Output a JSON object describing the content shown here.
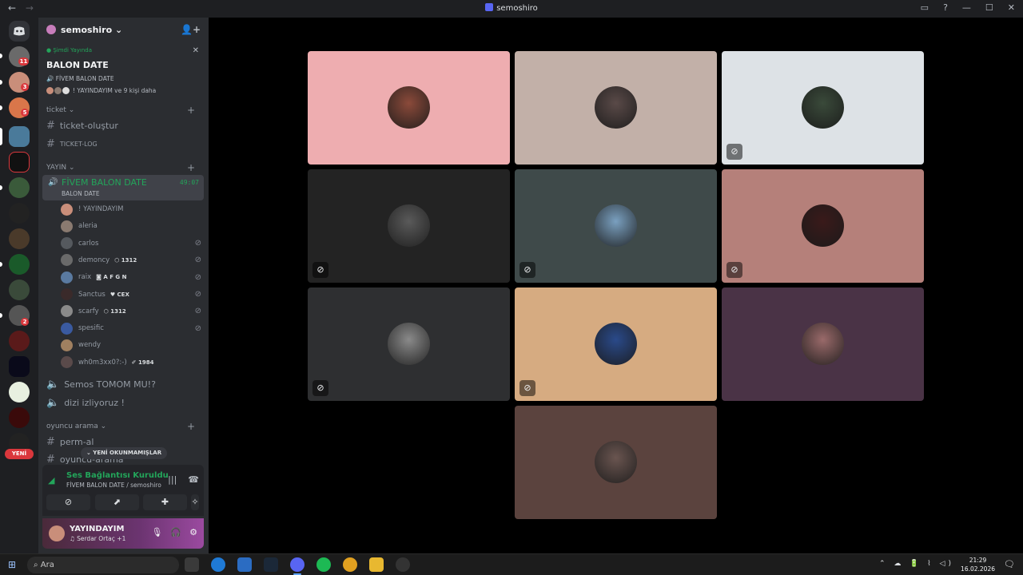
{
  "window": {
    "title": "semoshiro",
    "nav_back": "←",
    "nav_fwd": "→",
    "ctrl_inbox": "▭",
    "ctrl_help": "?",
    "ctrl_min": "—",
    "ctrl_max": "☐",
    "ctrl_close": "✕"
  },
  "server": {
    "name": "semoshiro ⌄",
    "invite_icon": "👤+"
  },
  "event": {
    "live_label": "● Şimdi Yayında",
    "title": "BALON DATE",
    "channel": "🔊 FİVEM BALON DATE",
    "participants": "! YAYINDAYIM ve 9 kişi daha",
    "close": "✕"
  },
  "guild_badges": [
    "11",
    "3",
    "5",
    "2"
  ],
  "yeni_label": "YENİ",
  "categories": {
    "ticket": "ticket ⌄",
    "yayin": "YAYIN ⌄",
    "oyuncu": "oyuncu arama ⌄",
    "plus": "+"
  },
  "channels": {
    "ticket_olustur": "ticket-oluştur",
    "ticket_log": "TICKET-LOG",
    "voice_active": "FİVEM BALON DATE",
    "voice_active_sub": "BALON DATE",
    "voice_timer": "49:07",
    "semos": "Semos TOMOM MU!?",
    "dizi": "dizi izliyoruz !",
    "perm_al": "perm-al",
    "oyuncu_arama": "oyuncu-arama"
  },
  "voice_users": [
    {
      "name": "! YAYINDAYIM",
      "tag": "",
      "muted": false,
      "color": "#c98e7a"
    },
    {
      "name": "aleria",
      "tag": "",
      "muted": false,
      "color": "#8a7a70"
    },
    {
      "name": "carlos",
      "tag": "",
      "muted": true,
      "color": "#55595e"
    },
    {
      "name": "demoncy",
      "tag": "⬡ 1312",
      "muted": true,
      "color": "#6a6a6a"
    },
    {
      "name": "raix",
      "tag": "◙ A F G N",
      "muted": true,
      "color": "#5a7aa0"
    },
    {
      "name": "Sanctus",
      "tag": "♥ CEX",
      "muted": true,
      "color": "#3a2a2a"
    },
    {
      "name": "scarfy",
      "tag": "⬡ 1312",
      "muted": true,
      "color": "#8a8a8a"
    },
    {
      "name": "spesific",
      "tag": "",
      "muted": true,
      "color": "#3a5aa0"
    },
    {
      "name": "wendy",
      "tag": "",
      "muted": false,
      "color": "#a08060"
    },
    {
      "name": "wh0m3xx0?:-)",
      "tag": "✐ 1984",
      "muted": false,
      "color": "#5a4a4a"
    }
  ],
  "unread_pill": "⌄ YENİ OKUNMAMIŞLAR",
  "connection": {
    "status": "Ses Bağlantısı Kuruldu",
    "detail": "FİVEM BALON DATE / semoshiro",
    "wave": "|||",
    "disconnect": "☎"
  },
  "controls": [
    "⊘",
    "⬈",
    "✚",
    "✧"
  ],
  "user": {
    "name": "YAYINDAYIM",
    "status": "♫ Serdar Ortaç +1",
    "mic": "🎙",
    "headset": "🎧",
    "settings": "⚙"
  },
  "tiles": [
    {
      "bg": "#eeadb0",
      "avatar": "#8b4a3a",
      "muted": false
    },
    {
      "bg": "#c2b0a8",
      "avatar": "#5a4a48",
      "muted": false
    },
    {
      "bg": "#dde2e6",
      "avatar": "#3a4a3a",
      "muted": true
    },
    {
      "bg": "#232323",
      "avatar": "#5a5a5a",
      "muted": true
    },
    {
      "bg": "#3f4a4a",
      "avatar": "#7aa0c0",
      "muted": true
    },
    {
      "bg": "#b5807a",
      "avatar": "#3a1a1a",
      "muted": true
    },
    {
      "bg": "#2e2f31",
      "avatar": "#8a8a8a",
      "muted": true
    },
    {
      "bg": "#d6ab81",
      "avatar": "#2a4a8a",
      "muted": true
    },
    {
      "bg": "#4a3346",
      "avatar": "#9a6a6a",
      "muted": false
    },
    {
      "bg": "#5b433e",
      "avatar": "#6a5550",
      "muted": false
    }
  ],
  "mute_icon": "⊘",
  "taskbar": {
    "start": "⊞",
    "search": "⌕  Ara",
    "tray": "⌃ ☁ 🔋 ⌇ ◁)",
    "time": "21:29",
    "date": "16.02.2026",
    "notif": "🗨"
  }
}
